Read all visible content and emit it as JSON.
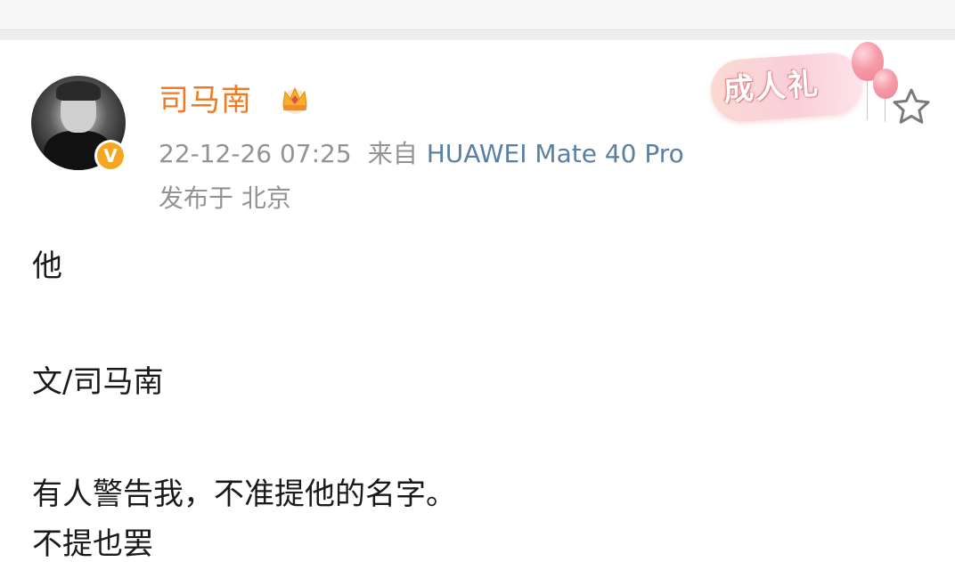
{
  "post": {
    "author": {
      "name": "司马南",
      "avatar_icon": "avatar",
      "verified_icon": "verified-v-icon",
      "verified_letter": "V",
      "member_icon": "crown-icon"
    },
    "meta": {
      "time": "22-12-26 07:25",
      "from_label": "来自",
      "device": "HUAWEI Mate 40 Pro",
      "location": "发布于 北京"
    },
    "badge": {
      "label": "成人礼",
      "decoration_icon": "balloon-icon"
    },
    "favorite_icon": "star-outline-icon",
    "content": {
      "p1": "他",
      "p2": "文/司马南",
      "p3": "有人警告我，不准提他的名字。",
      "p4": "不提也罢"
    }
  },
  "colors": {
    "username": "#ef7a23",
    "meta_text": "#939393",
    "device_link": "#5a7fa3",
    "body_text": "#1a1a1a",
    "verified": "#f5a623"
  }
}
